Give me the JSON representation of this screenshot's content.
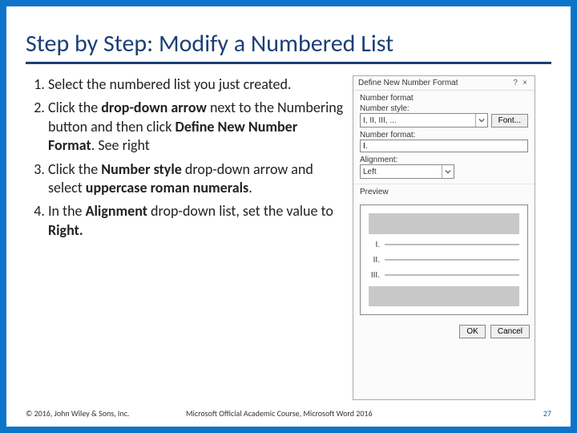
{
  "title": "Step by Step: Modify a Numbered List",
  "steps": [
    {
      "pre": "Select the numbered list you just created."
    },
    {
      "pre": "Click the ",
      "b1": "drop-down arrow",
      "mid": " next to the Numbering button and then click ",
      "b2": "Define New Number Format",
      "post": ". See right"
    },
    {
      "pre": "Click the ",
      "b1": "Number style",
      "mid": " drop-down arrow and select ",
      "b2": "uppercase roman numerals",
      "post": "."
    },
    {
      "pre": "In the ",
      "b1": "Alignment",
      "mid": " drop-down list, set the value to ",
      "b2": "Right.",
      "post": ""
    }
  ],
  "dialog": {
    "title": "Define New Number Format",
    "help": "?",
    "close": "×",
    "section1": "Number format",
    "lbl_style": "Number style:",
    "style_value": "I, II, III, ...",
    "font_btn": "Font...",
    "lbl_format": "Number format:",
    "format_value": "I.",
    "lbl_align": "Alignment:",
    "align_value": "Left",
    "preview_lbl": "Preview",
    "preview_items": [
      "I.",
      "II.",
      "III."
    ],
    "ok": "OK",
    "cancel": "Cancel"
  },
  "footer": {
    "left": "© 2016, John Wiley & Sons, Inc.",
    "center": "Microsoft Official Academic Course, Microsoft Word 2016",
    "page": "27"
  }
}
